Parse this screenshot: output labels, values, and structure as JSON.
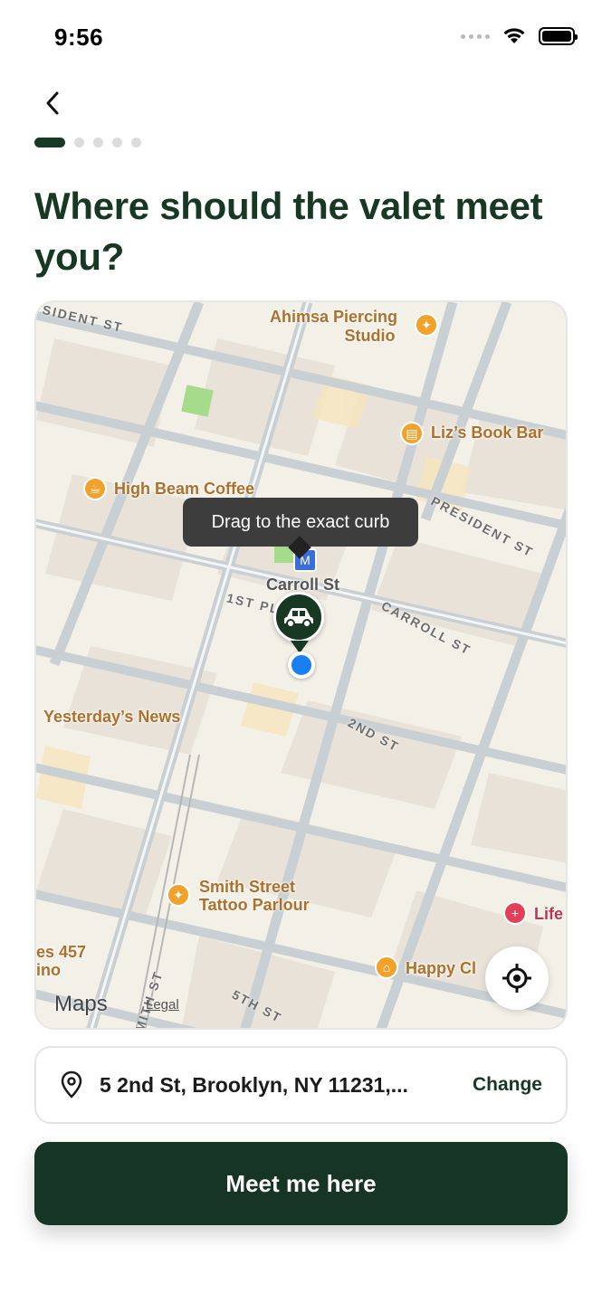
{
  "status_bar": {
    "time": "9:56"
  },
  "page": {
    "title": "Where should the valet meet you?",
    "progress": {
      "current_step": 1,
      "total_steps": 5
    }
  },
  "map": {
    "tooltip": "Drag to the exact curb",
    "brand": "Maps",
    "legal": "Legal",
    "pois": {
      "ahimsa_line1": "Ahimsa Piercing",
      "ahimsa_line2": "Studio",
      "lizs": "Liz’s Book Bar",
      "high_beam": "High Beam Coffee",
      "carroll_station": "Carroll St",
      "yesterdays": "Yesterday’s News",
      "smith_line1": "Smith Street",
      "smith_line2": "Tattoo Parlour",
      "life": "Life",
      "happy": "Happy Cl",
      "es457_line1": "es 457",
      "es457_line2": "ino"
    },
    "streets": {
      "president_top": "SIDENT ST",
      "president_right": "PRESIDENT ST",
      "first_pl": "1ST PL",
      "carroll": "CARROLL ST",
      "second": "2ND ST",
      "fifth": "5TH ST",
      "smith": "SMITH ST"
    },
    "colors": {
      "accent": "#173822",
      "user_dot": "#1a7ff2",
      "poi_orange": "#f0a22b",
      "poi_red": "#e0405a"
    }
  },
  "address": {
    "text": "5 2nd St, Brooklyn, NY 11231,...",
    "change_label": "Change"
  },
  "cta": {
    "label": "Meet me here"
  }
}
